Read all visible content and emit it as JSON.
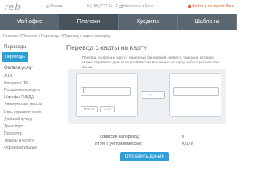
{
  "header": {
    "logo": "reb",
    "city": "Москва",
    "phone": "8 (495) 777-11-11",
    "contact": "Написать в банк",
    "internet_bank": "Войти в интернет-банк"
  },
  "main_nav": [
    "Мой офис",
    "Платежи",
    "Кредиты",
    "Шаблоны"
  ],
  "breadcrumb": "Главная / Платежи / Переводы / Перевод с карты на карту",
  "sidebar": {
    "section_title": "Переводы",
    "active_item": "Переводы",
    "payments_title": "Оплата услуг",
    "items": [
      "ЖКХ",
      "Интернет, ТВ",
      "Погашение кредита",
      "Штрафы ГИБДД",
      "Электронные деньги",
      "Игры и развлечения",
      "Дальний доход",
      "Транспорт",
      "Госуслуги",
      "Товары и услуги",
      "Образовательные"
    ]
  },
  "content": {
    "title": "Перевод с карты на карту",
    "description": "Перевод с карты на карту - надежный банковский сервис с помощью которого можно перевести деньги по всей России мгновенно на карту любого российского банка.",
    "card_number_placeholder": "|____",
    "mmyy": "MM/YY",
    "cvv": "CVV",
    "commission_label": "Комиссия за перевод:",
    "commission_value": "0",
    "total_label": "Итого с учетом комиссии:",
    "total_value": "0,00 ₽",
    "send_button": "Отправить деньги"
  }
}
